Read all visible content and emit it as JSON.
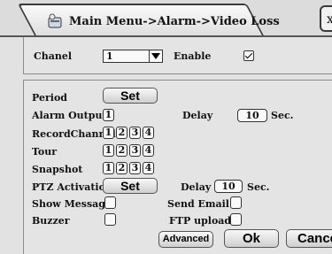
{
  "title": {
    "text": "Main Menu->Alarm->Video Loss",
    "close_glyph": "x"
  },
  "top": {
    "channel_label": "Chanel",
    "channel_value": "1",
    "enable_label": "Enable",
    "enable_checked": true
  },
  "period": {
    "label": "Period",
    "button": "Set"
  },
  "alarm_output": {
    "label": "Alarm Output",
    "values": [
      "1"
    ]
  },
  "delay1": {
    "label": "Delay",
    "value": "10",
    "unit": "Sec."
  },
  "record_channel": {
    "label": "RecordChannel",
    "values": [
      "1",
      "2",
      "3",
      "4"
    ]
  },
  "tour": {
    "label": "Tour",
    "values": [
      "1",
      "2",
      "3",
      "4"
    ]
  },
  "snapshot": {
    "label": "Snapshot",
    "values": [
      "1",
      "2",
      "3",
      "4"
    ]
  },
  "ptz": {
    "label": "PTZ Activation",
    "button": "Set"
  },
  "delay2": {
    "label": "Delay",
    "value": "10",
    "unit": "Sec."
  },
  "show_message": {
    "label": "Show Message",
    "checked": false
  },
  "send_email": {
    "label": "Send Email",
    "checked": false
  },
  "buzzer": {
    "label": "Buzzer",
    "checked": false
  },
  "ftp_upload": {
    "label": "FTP upload",
    "checked": false
  },
  "footer": {
    "advanced": "Advanced",
    "ok": "Ok",
    "cancel": "Cancel"
  }
}
